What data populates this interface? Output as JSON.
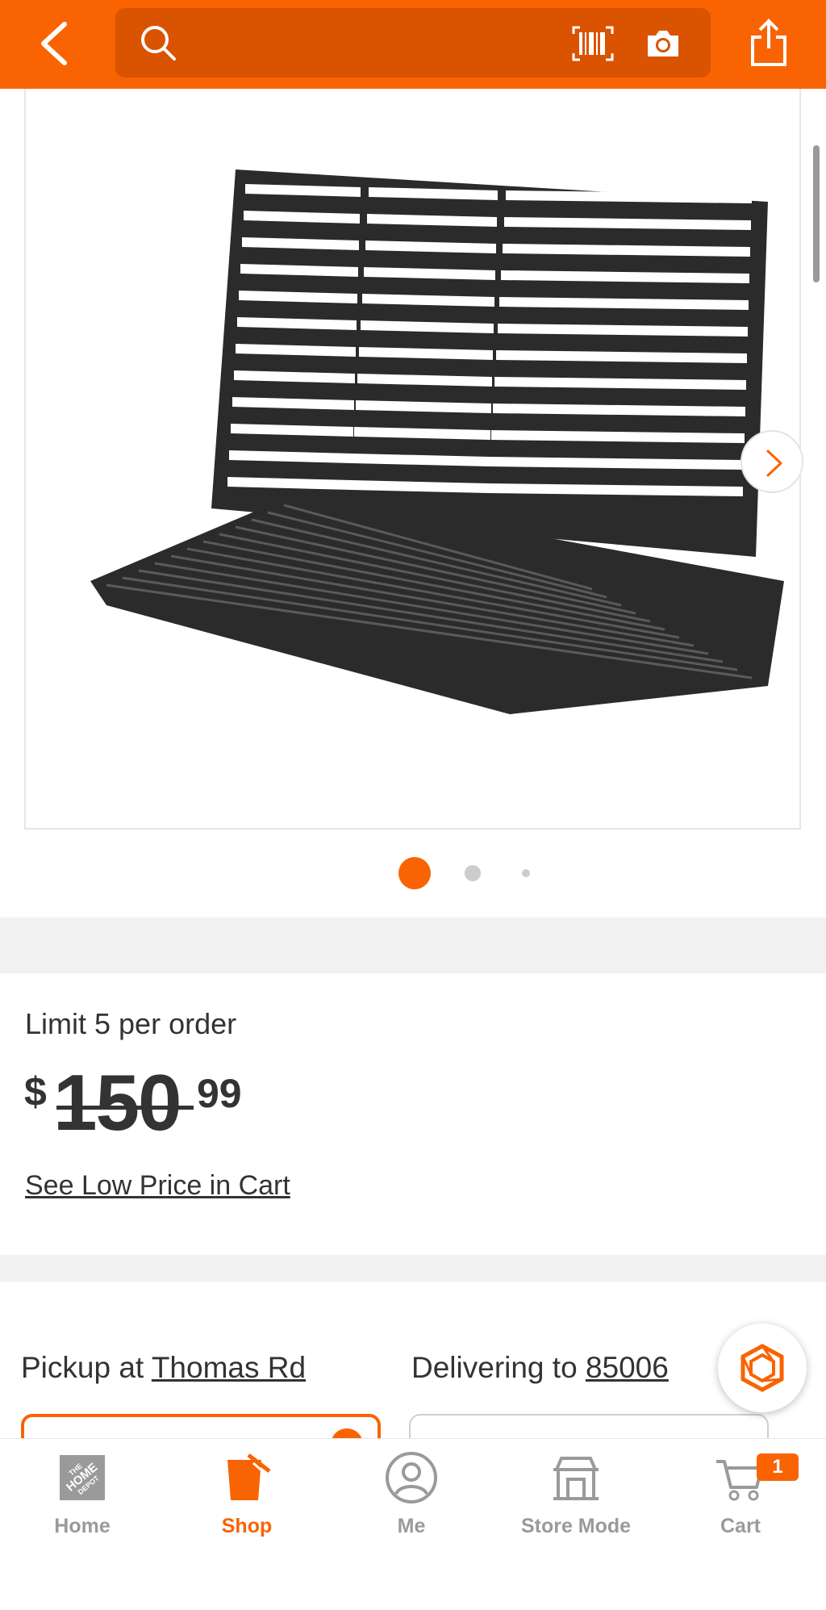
{
  "header": {
    "search_placeholder": "",
    "icons": [
      "back-icon",
      "search-icon",
      "barcode-icon",
      "camera-icon",
      "share-icon"
    ]
  },
  "gallery": {
    "dots": 3,
    "active_dot": 1
  },
  "price": {
    "limit_text": "Limit 5 per order",
    "currency": "$",
    "dollars": "150",
    "cents": "99",
    "low_price_link": "See Low Price in Cart"
  },
  "fulfillment": {
    "pickup_prefix": "Pickup at",
    "pickup_store": "Thomas Rd",
    "delivery_prefix": "Delivering to",
    "delivery_zip": "85006"
  },
  "tabbar": {
    "tabs": [
      {
        "label": "Home",
        "icon": "home-depot-logo-icon"
      },
      {
        "label": "Shop",
        "icon": "shop-bucket-icon"
      },
      {
        "label": "Me",
        "icon": "user-icon"
      },
      {
        "label": "Store Mode",
        "icon": "store-icon"
      },
      {
        "label": "Cart",
        "icon": "cart-icon"
      }
    ],
    "active": "Shop",
    "cart_count": "1"
  },
  "colors": {
    "brand": "#F96302",
    "search_bg": "#D95300",
    "text": "#333333",
    "muted": "#9a9a9a"
  }
}
